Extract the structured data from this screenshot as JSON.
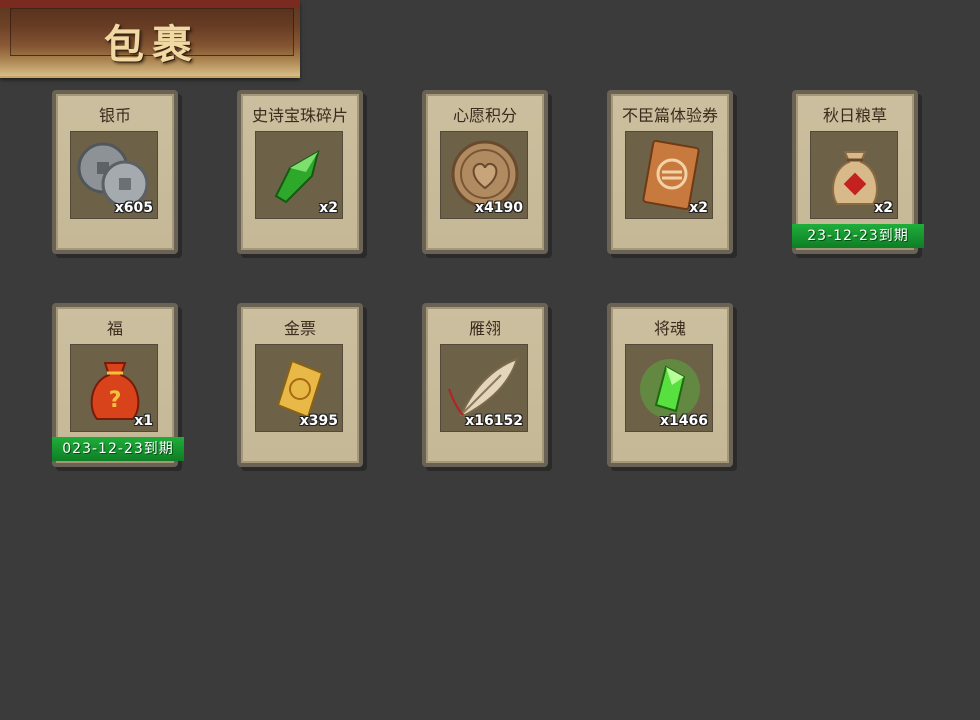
{
  "window": {
    "title": "包裹"
  },
  "items": [
    {
      "name": "银币",
      "quantity": "x605",
      "icon": "silver-coins-icon",
      "expiry": ""
    },
    {
      "name": "史诗宝珠碎片",
      "quantity": "x2",
      "icon": "green-gem-shard-icon",
      "expiry": ""
    },
    {
      "name": "心愿积分",
      "quantity": "x4190",
      "icon": "heart-coin-icon",
      "expiry": ""
    },
    {
      "name": "不臣篇体验券",
      "quantity": "x2",
      "icon": "ticket-icon",
      "expiry": ""
    },
    {
      "name": "秋日粮草",
      "quantity": "x2",
      "icon": "grain-sack-icon",
      "expiry": "23-12-23到期"
    },
    {
      "name": "福",
      "quantity": "x1",
      "icon": "lucky-bag-icon",
      "expiry": "023-12-23到期"
    },
    {
      "name": "金票",
      "quantity": "x395",
      "icon": "gold-scroll-icon",
      "expiry": ""
    },
    {
      "name": "雁翎",
      "quantity": "x16152",
      "icon": "feather-icon",
      "expiry": ""
    },
    {
      "name": "将魂",
      "quantity": "x1466",
      "icon": "spirit-crystal-icon",
      "expiry": ""
    }
  ],
  "colors": {
    "background": "#3b3b3b",
    "card": "#c8bb99",
    "expiry": "#129a30"
  }
}
